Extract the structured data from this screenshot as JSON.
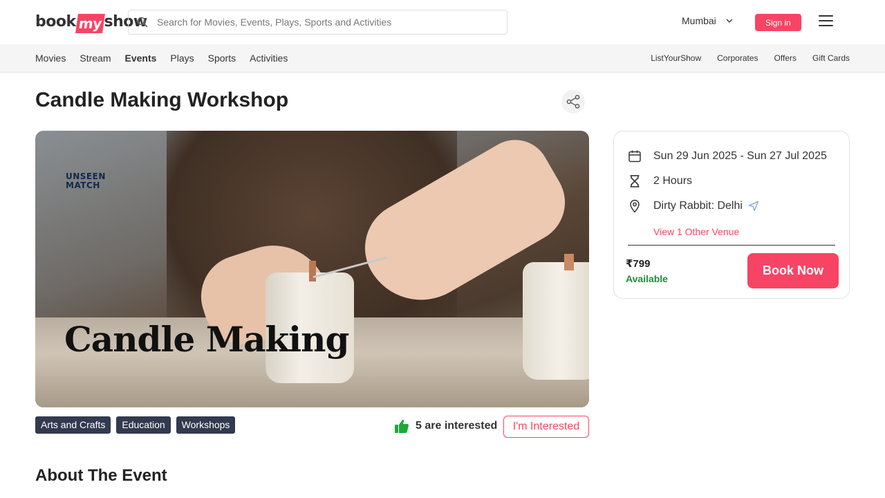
{
  "header": {
    "logo": {
      "part1": "book",
      "part2": "my",
      "part3": "show"
    },
    "search_placeholder": "Search for Movies, Events, Plays, Sports and Activities",
    "city": "Mumbai",
    "signin_label": "Sign in"
  },
  "subnav": {
    "left_items": [
      "Movies",
      "Stream",
      "Events",
      "Plays",
      "Sports",
      "Activities"
    ],
    "active": "Events",
    "right_items": [
      "ListYourShow",
      "Corporates",
      "Offers",
      "Gift Cards"
    ]
  },
  "event": {
    "title": "Candle Making Workshop",
    "banner_brand": "UNSEEN MATCH",
    "banner_caption": "Candle Making",
    "tags": [
      "Arts and Crafts",
      "Education",
      "Workshops"
    ],
    "interest_text": "5 are interested",
    "interested_label": "I'm Interested",
    "about_heading": "About The Event"
  },
  "booking": {
    "dates": "Sun 29 Jun 2025 - Sun 27 Jul 2025",
    "duration": "2 Hours",
    "venue": "Dirty Rabbit: Delhi",
    "other_venue": "View 1 Other Venue",
    "price": "₹799",
    "availability": "Available",
    "book_label": "Book Now"
  },
  "colors": {
    "accent": "#f84464",
    "available": "#1e8f3a",
    "tag_bg": "#333a4f",
    "thumb": "#1ea83c"
  },
  "icons": [
    "search-icon",
    "chevron-down-icon",
    "hamburger-icon",
    "share-icon",
    "calendar-icon",
    "hourglass-icon",
    "location-pin-icon",
    "navigate-arrow-icon",
    "thumbs-up-icon"
  ]
}
